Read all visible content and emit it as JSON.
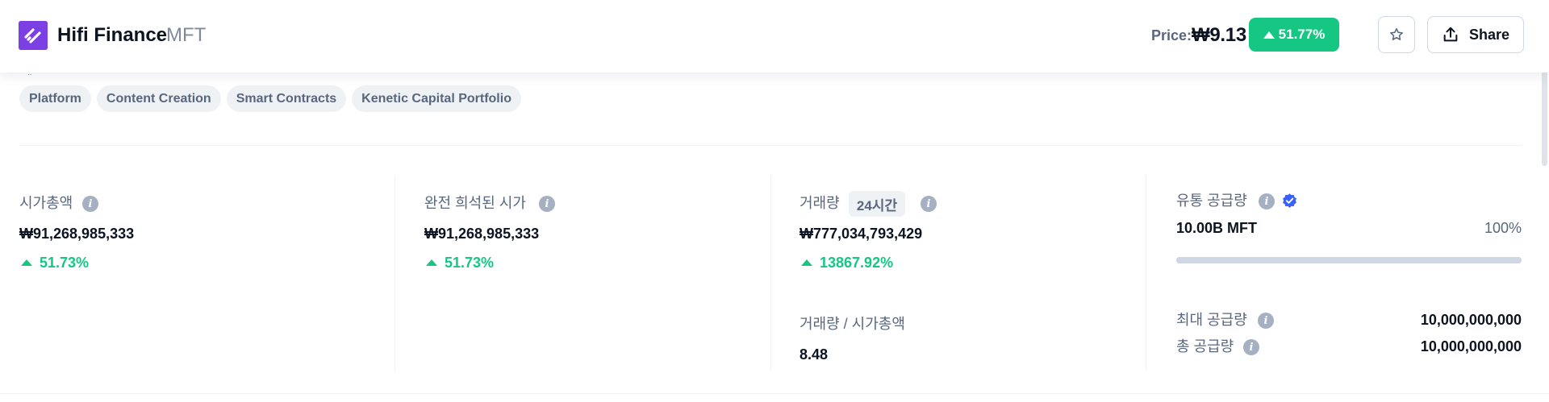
{
  "header": {
    "name": "Hifi Finance",
    "symbol": "MFT",
    "price_label": "Price:",
    "price_value": "₩9.13",
    "price_change": "51.77%",
    "share_label": "Share",
    "icons": {
      "logo": "hifi-logo",
      "star": "star-icon",
      "share": "share-icon"
    }
  },
  "tag_stub": "..",
  "tags": [
    "Platform",
    "Content Creation",
    "Smart Contracts",
    "Kenetic Capital Portfolio"
  ],
  "stats": {
    "market_cap": {
      "label": "시가총액",
      "value": "₩91,268,985,333",
      "change": "51.73%"
    },
    "fdv": {
      "label": "완전 희석된 시가",
      "value": "₩91,268,985,333",
      "change": "51.73%"
    },
    "volume": {
      "label": "거래량",
      "period": "24시간",
      "value": "₩777,034,793,429",
      "change": "13867.92%"
    },
    "vol_mcap": {
      "label": "거래량 / 시가총액",
      "value": "8.48"
    },
    "circulating": {
      "label": "유통 공급량",
      "value": "10.00B MFT",
      "percent": "100%",
      "progress": 1.0
    },
    "max_supply": {
      "label": "최대 공급량",
      "value": "10,000,000,000"
    },
    "total_supply": {
      "label": "총 공급량",
      "value": "10,000,000,000"
    }
  },
  "colors": {
    "accent_green": "#16c784",
    "brand_purple": "#7b3fe4",
    "verified_blue": "#3861fb",
    "muted": "#58667e"
  }
}
